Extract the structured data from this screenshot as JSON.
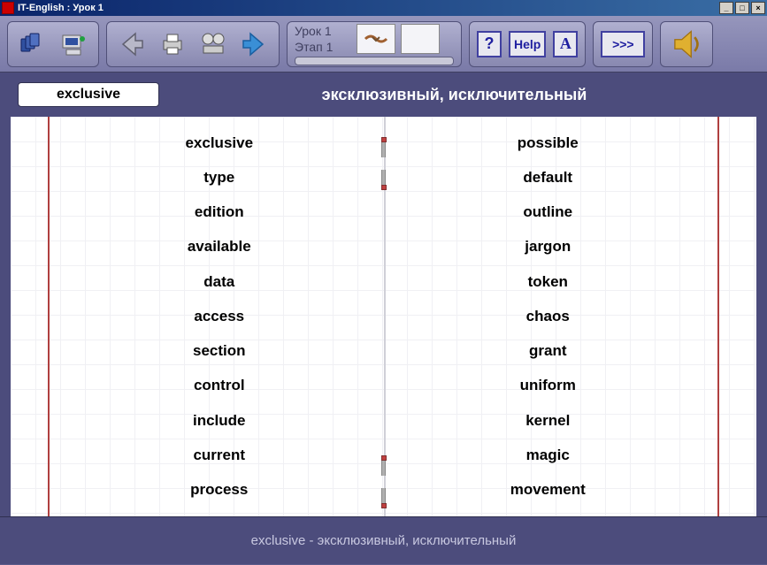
{
  "window": {
    "title": "IT-English : Урок 1"
  },
  "toolbar": {
    "lesson_line1": "Урок 1",
    "lesson_line2": "Этап 1",
    "help_q": "?",
    "help_label": "Help",
    "font_label": "A",
    "skip_label": ">>>"
  },
  "header": {
    "word": "exclusive",
    "translation": "эксклюзивный, исключительный"
  },
  "words": {
    "left": [
      "exclusive",
      "type",
      "edition",
      "available",
      "data",
      "access",
      "section",
      "control",
      "include",
      "current",
      "process"
    ],
    "right": [
      "possible",
      "default",
      "outline",
      "jargon",
      "token",
      "chaos",
      "grant",
      "uniform",
      "kernel",
      "magic",
      "movement"
    ]
  },
  "footer": {
    "text": "exclusive  -  эксклюзивный, исключительный"
  }
}
